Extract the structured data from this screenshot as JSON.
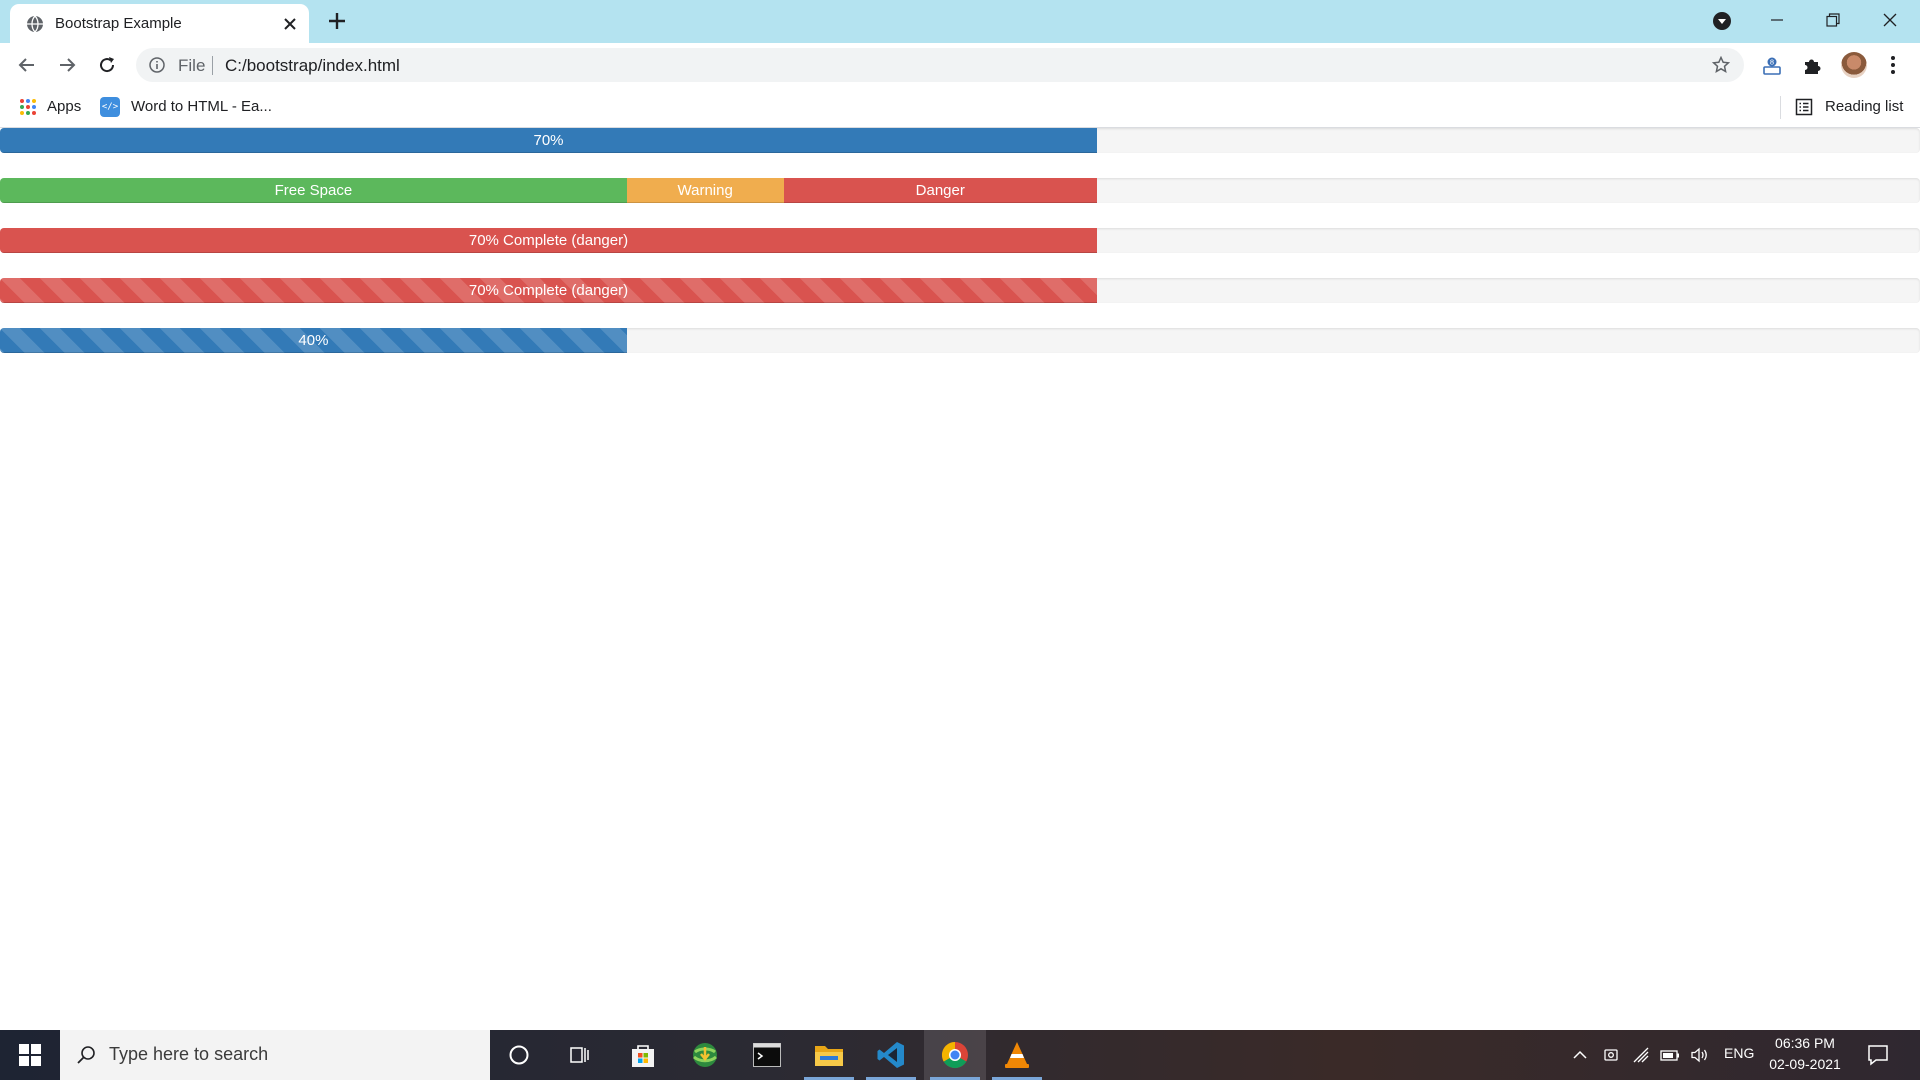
{
  "browser": {
    "tab_title": "Bootstrap Example",
    "url_scheme": "File",
    "url": "C:/bootstrap/index.html",
    "bookmarks": [
      {
        "label": "Apps",
        "icon": "apps-grid-icon"
      },
      {
        "label": "Word to HTML - Ea...",
        "icon": "word-to-html-icon"
      }
    ],
    "reading_list_label": "Reading list"
  },
  "progress_bars": [
    {
      "segments": [
        {
          "label": "70%",
          "value": 70,
          "variant": "primary",
          "striped": false
        }
      ]
    },
    {
      "segments": [
        {
          "label": "Free Space",
          "value": 40,
          "variant": "success",
          "striped": false
        },
        {
          "label": "Warning",
          "value": 10,
          "variant": "warning",
          "striped": false
        },
        {
          "label": "Danger",
          "value": 20,
          "variant": "danger",
          "striped": false
        }
      ]
    },
    {
      "segments": [
        {
          "label": "70% Complete (danger)",
          "value": 70,
          "variant": "danger",
          "striped": false
        }
      ]
    },
    {
      "segments": [
        {
          "label": "70% Complete (danger)",
          "value": 70,
          "variant": "danger",
          "striped": true
        }
      ]
    },
    {
      "segments": [
        {
          "label": "40%",
          "value": 40,
          "variant": "primary",
          "striped": true
        }
      ]
    }
  ],
  "colors": {
    "primary": "#337ab7",
    "success": "#5cb85c",
    "warning": "#f0ad4e",
    "danger": "#d9534f",
    "track": "#f5f5f5",
    "titlebar": "#b4e3f0"
  },
  "taskbar": {
    "search_placeholder": "Type here to search",
    "apps": [
      "cortana-icon",
      "task-view-icon",
      "store-icon",
      "internet-download-icon",
      "terminal-icon",
      "file-explorer-icon",
      "vscode-icon",
      "chrome-icon",
      "vlc-icon"
    ],
    "language": "ENG",
    "time": "06:36 PM",
    "date": "02-09-2021"
  }
}
